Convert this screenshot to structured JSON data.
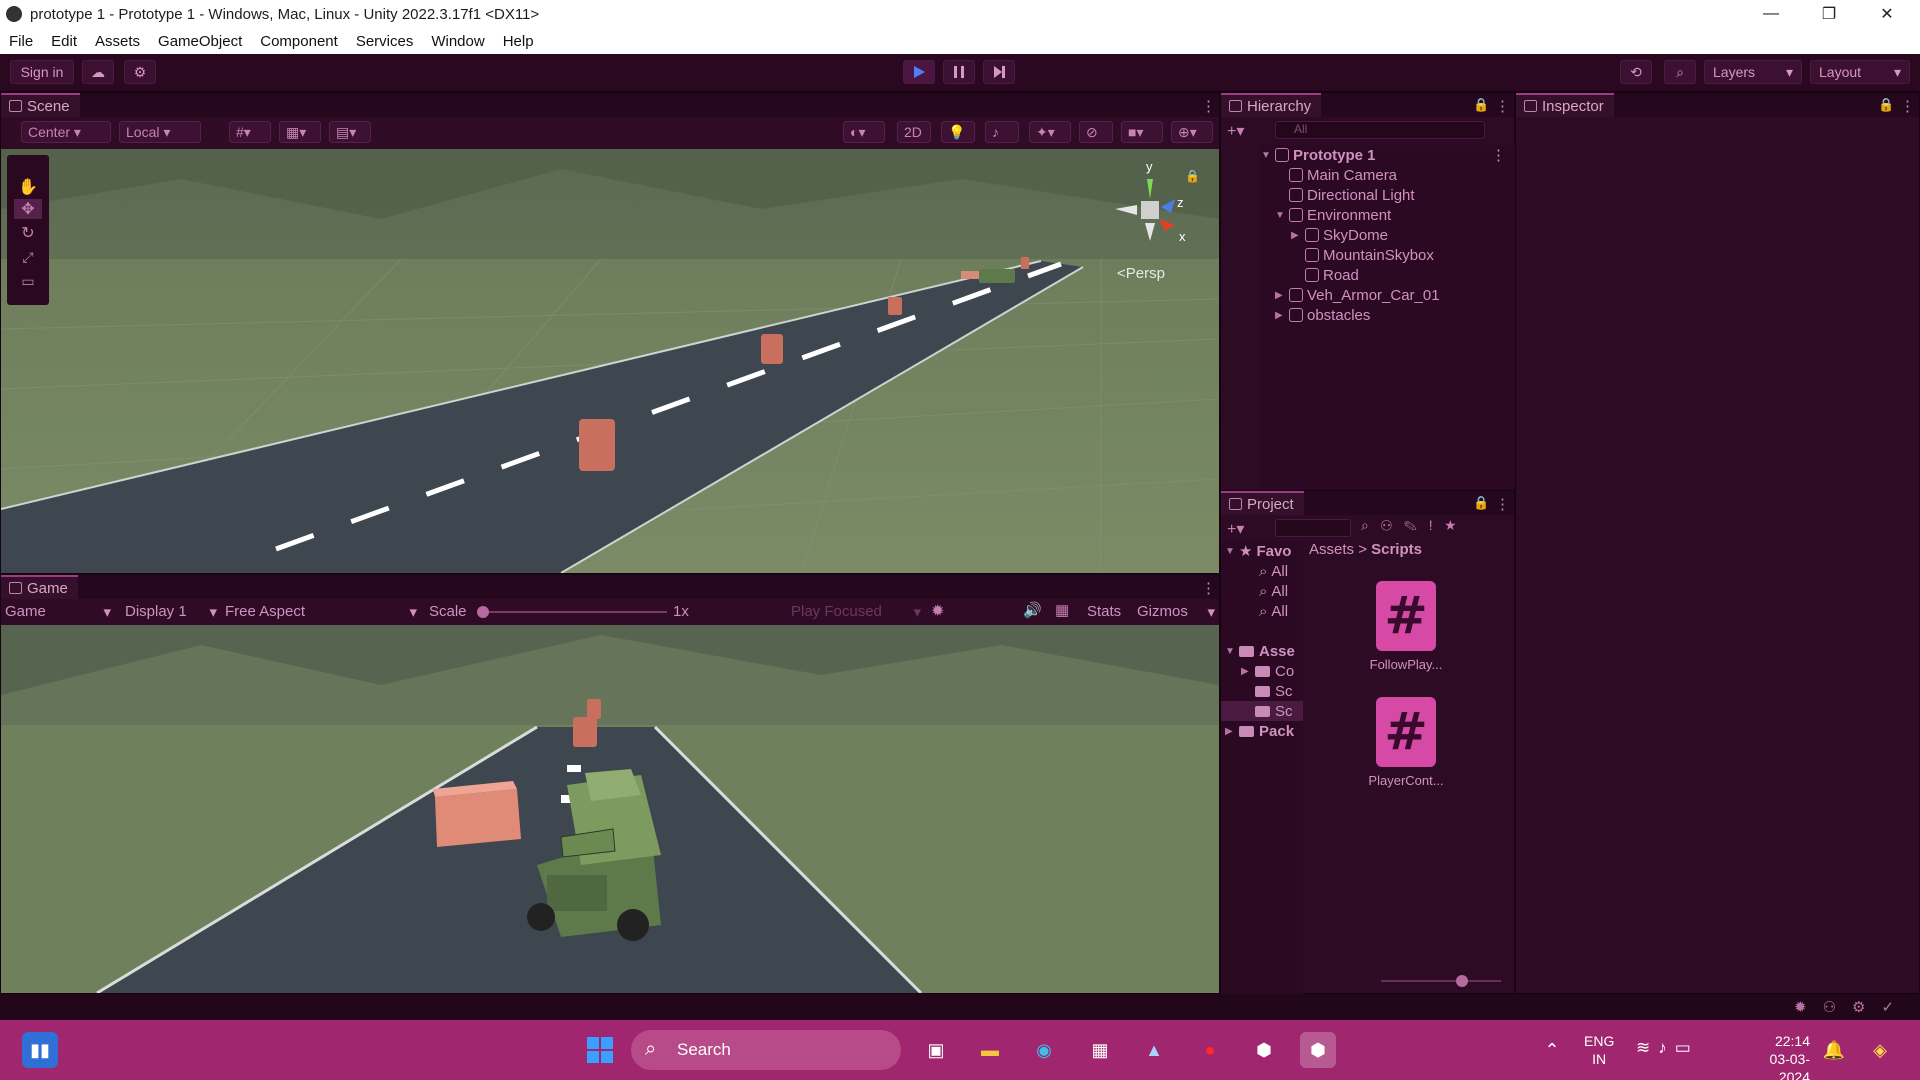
{
  "window": {
    "title": "prototype 1 - Prototype 1 - Windows, Mac, Linux - Unity 2022.3.17f1 <DX11>",
    "minimize": "—",
    "maximize": "❐",
    "close": "✕"
  },
  "menu": [
    "File",
    "Edit",
    "Assets",
    "GameObject",
    "Component",
    "Services",
    "Window",
    "Help"
  ],
  "toolbar": {
    "sign_in": "Sign in",
    "layers": "Layers",
    "layout": "Layout",
    "play_icon": "play-icon",
    "pause_icon": "pause-icon",
    "step_icon": "step-icon"
  },
  "scene": {
    "tab": "Scene",
    "pivot": "Center",
    "space": "Local",
    "mode_2d": "2D",
    "persp": "<Persp",
    "gizmo_y": "y",
    "gizmo_z": "z",
    "gizmo_x": "x"
  },
  "game": {
    "tab": "Game",
    "view": "Game",
    "display": "Display 1",
    "aspect": "Free Aspect",
    "scale_label": "Scale",
    "scale_value": "1x",
    "play_focused": "Play Focused",
    "stats": "Stats",
    "gizmos": "Gizmos"
  },
  "hierarchy": {
    "tab": "Hierarchy",
    "search_placeholder": "All",
    "items": [
      {
        "label": "Prototype 1"
      },
      {
        "label": "Main Camera"
      },
      {
        "label": "Directional Light"
      },
      {
        "label": "Environment"
      },
      {
        "label": "SkyDome"
      },
      {
        "label": "MountainSkybox"
      },
      {
        "label": "Road"
      },
      {
        "label": "Veh_Armor_Car_01"
      },
      {
        "label": "obstacles"
      }
    ]
  },
  "inspector": {
    "tab": "Inspector"
  },
  "project": {
    "tab": "Project",
    "breadcrumb_root": "Assets",
    "breadcrumb_sep": ">",
    "breadcrumb_current": "Scripts",
    "tree": [
      {
        "label": "Favo"
      },
      {
        "label": "All"
      },
      {
        "label": "All"
      },
      {
        "label": "All"
      },
      {
        "label": "Asse"
      },
      {
        "label": "Co"
      },
      {
        "label": "Sc"
      },
      {
        "label": "Sc"
      },
      {
        "label": "Pack"
      }
    ],
    "assets": [
      {
        "label": "FollowPlay...",
        "glyph": "#"
      },
      {
        "label": "PlayerCont...",
        "glyph": "#"
      }
    ]
  },
  "taskbar": {
    "search": "Search",
    "lang_1": "ENG",
    "lang_2": "IN",
    "time": "22:14",
    "date": "03-03-2024"
  }
}
